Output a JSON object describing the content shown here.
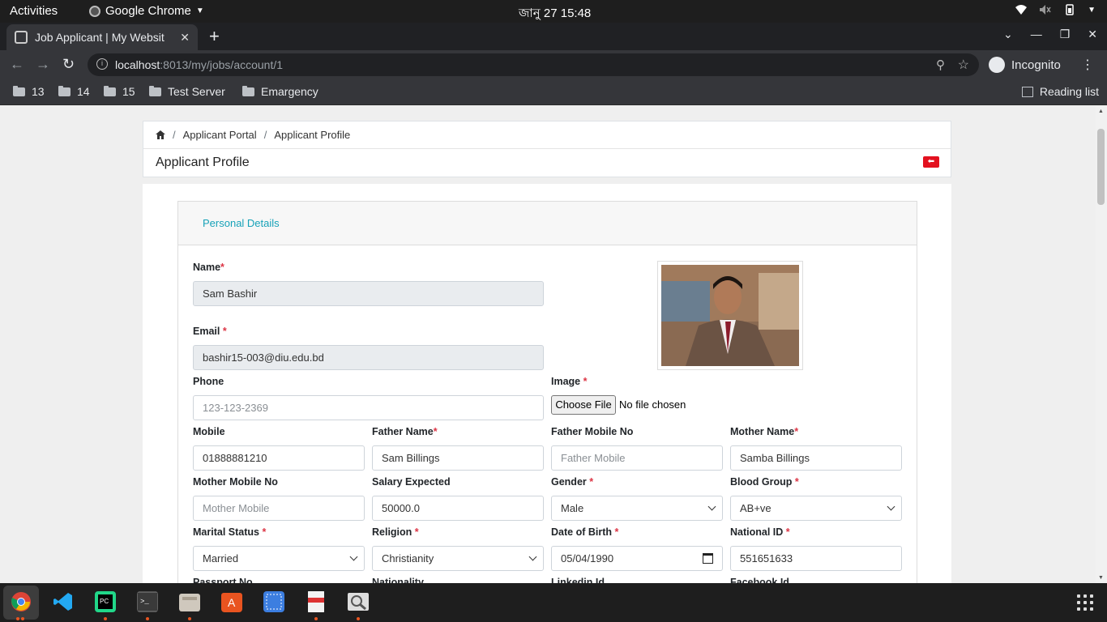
{
  "topbar": {
    "activities": "Activities",
    "app_name": "Google Chrome",
    "clock": "জানু 27  15:48"
  },
  "browser": {
    "tab_title": "Job Applicant | My Websit",
    "url_host": "localhost",
    "url_path": ":8013/my/jobs/account/1",
    "profile_label": "Incognito",
    "bookmarks": [
      "13",
      "14",
      "15",
      "Test Server",
      "Emargency"
    ],
    "reading_list": "Reading list"
  },
  "page": {
    "breadcrumb": [
      "Applicant Portal",
      "Applicant Profile"
    ],
    "title": "Applicant Profile",
    "section_title": "Personal Details"
  },
  "form": {
    "name": {
      "label": "Name",
      "value": "Sam Bashir"
    },
    "email": {
      "label": "Email",
      "value": "bashir15-003@diu.edu.bd"
    },
    "phone": {
      "label": "Phone",
      "placeholder": "123-123-2369"
    },
    "image": {
      "label": "Image",
      "button": "Choose File",
      "status": "No file chosen"
    },
    "mobile": {
      "label": "Mobile",
      "value": "01888881210"
    },
    "father_name": {
      "label": "Father Name",
      "value": "Sam Billings"
    },
    "father_mobile": {
      "label": "Father Mobile No",
      "placeholder": "Father Mobile"
    },
    "mother_name": {
      "label": "Mother Name",
      "value": "Samba Billings"
    },
    "mother_mobile": {
      "label": "Mother Mobile No",
      "placeholder": "Mother Mobile"
    },
    "salary": {
      "label": "Salary Expected",
      "value": "50000.0"
    },
    "gender": {
      "label": "Gender",
      "value": "Male"
    },
    "blood_group": {
      "label": "Blood Group",
      "value": "AB+ve"
    },
    "marital_status": {
      "label": "Marital Status",
      "value": "Married"
    },
    "religion": {
      "label": "Religion",
      "value": "Christianity"
    },
    "dob": {
      "label": "Date of Birth",
      "value": "05/04/1990"
    },
    "national_id": {
      "label": "National ID",
      "value": "551651633"
    },
    "passport": {
      "label": "Passport No"
    },
    "nationality": {
      "label": "Nationality"
    },
    "linkedin": {
      "label": "Linkedin Id"
    },
    "facebook": {
      "label": "Facebook Id"
    },
    "required_mark": "*"
  },
  "colors": {
    "accent_link": "#17a2b8",
    "required": "#dc3545",
    "back_button": "#e3111f"
  }
}
